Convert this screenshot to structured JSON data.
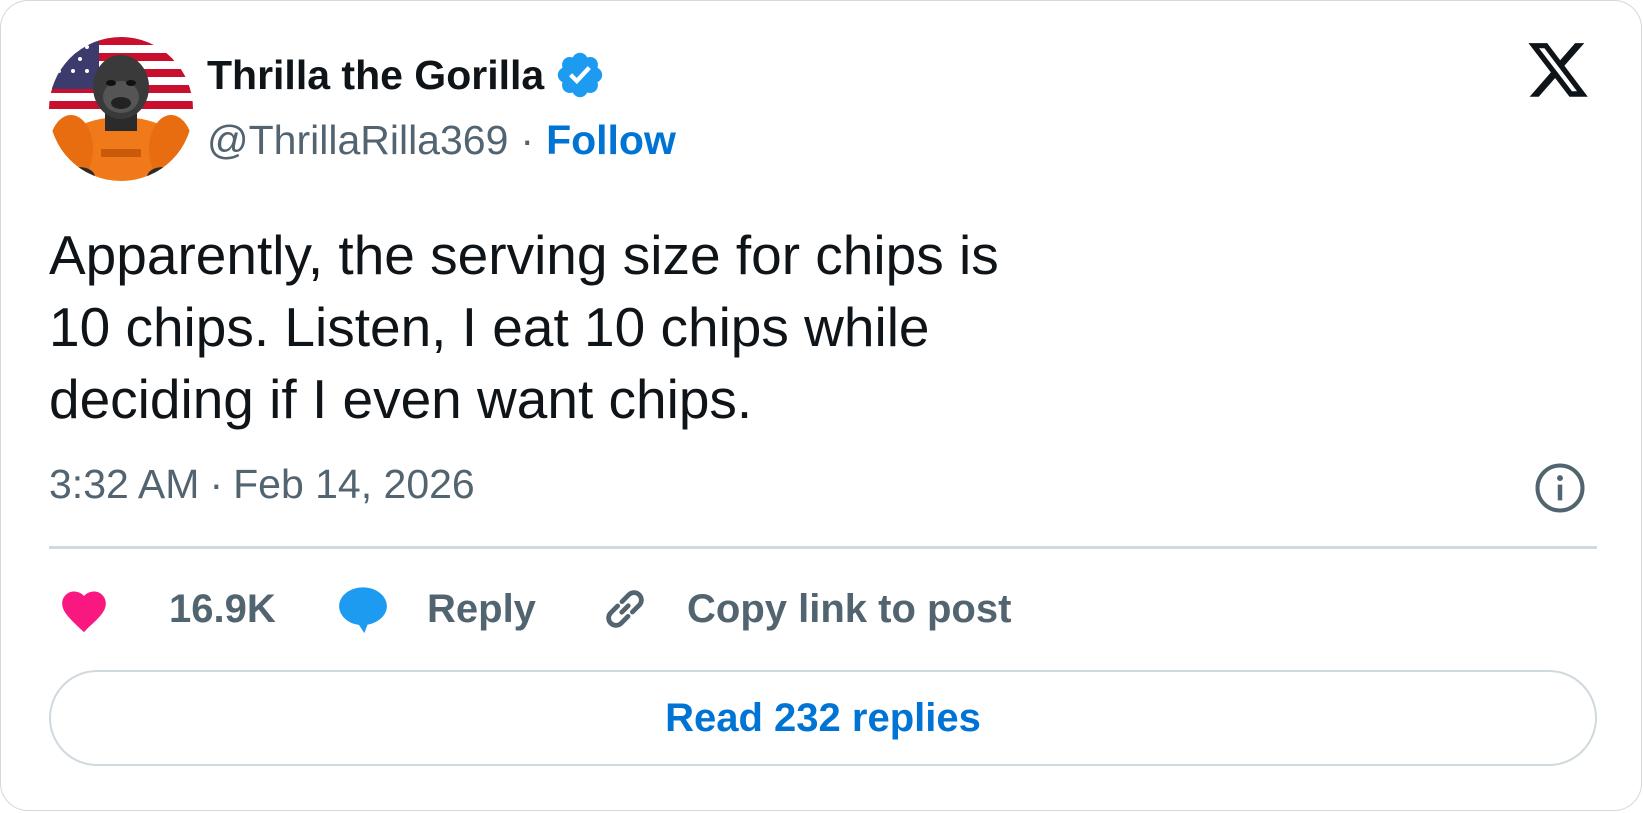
{
  "author": {
    "display_name": "Thrilla the Gorilla",
    "handle": "@ThrillaRilla369",
    "separator": "·",
    "follow_label": "Follow",
    "verified": true,
    "avatar_icon": "gorilla-avatar"
  },
  "post": {
    "text": "Apparently, the serving size for chips is 10 chips. Listen, I eat 10 chips while deciding if I even want chips.",
    "time": "3:32 AM",
    "date_separator": "·",
    "date": "Feb 14, 2026"
  },
  "actions": {
    "like_count": "16.9K",
    "reply_label": "Reply",
    "copy_link_label": "Copy link to post"
  },
  "footer": {
    "read_replies_label": "Read 232 replies"
  },
  "icons": {
    "brand": "x-logo-icon",
    "info": "info-icon",
    "like": "heart-icon",
    "reply": "speech-bubble-icon",
    "copy": "link-icon",
    "verified": "verified-badge-icon"
  },
  "colors": {
    "text_primary": "#0f1419",
    "text_secondary": "#536471",
    "link_blue": "#0074d4",
    "verified_blue": "#1d9bf0",
    "like_pink": "#f91880",
    "reply_blue": "#1d9bf0",
    "border": "#cfd9de"
  }
}
